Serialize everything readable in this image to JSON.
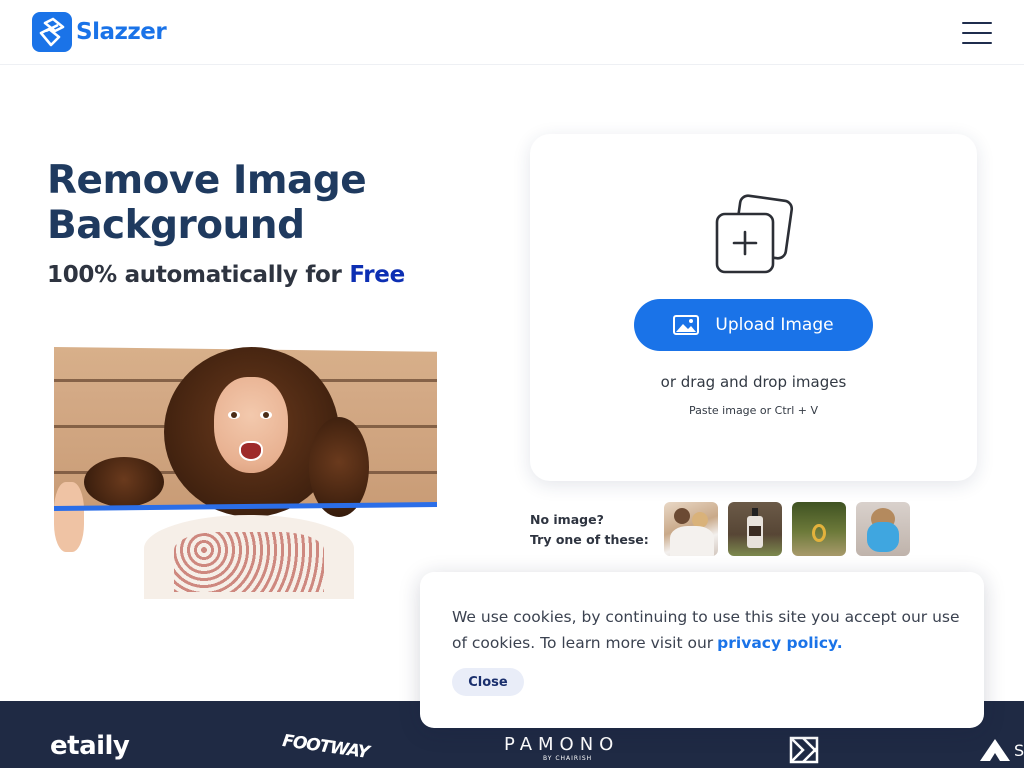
{
  "header": {
    "logo_text": "Slazzer",
    "logo_icon": "slazzer-logo-icon",
    "menu_icon": "hamburger-menu-icon"
  },
  "hero": {
    "title": "Remove Image Background",
    "subtitle_prefix": "100% automatically for ",
    "subtitle_free": "Free"
  },
  "upload": {
    "button_label": "Upload Image",
    "button_icon": "image-icon",
    "graphic_icon": "add-images-icon",
    "drag_text": "or drag and drop images",
    "paste_text": "Paste image or Ctrl + V"
  },
  "samples": {
    "label_line1": "No image?",
    "label_line2": "Try one of these:",
    "items": [
      "sample-couple",
      "sample-bottle",
      "sample-ring",
      "sample-teddy-bear"
    ]
  },
  "brands": {
    "etaily": "etaily",
    "footway": "FOOTWAY",
    "pamono": "PAMONO",
    "pamono_sub": "BY CHAIRISH",
    "last_partial": "S"
  },
  "cookie": {
    "text": "We use cookies, by continuing to use this site you accept our use of cookies.  To learn more visit our",
    "link_text": "privacy policy.",
    "close_label": "Close"
  },
  "colors": {
    "brand_blue": "#1a73e8",
    "title_navy": "#1f3a5f",
    "free_blue": "#0d2fb3",
    "strip_bg": "#1f2a44"
  }
}
